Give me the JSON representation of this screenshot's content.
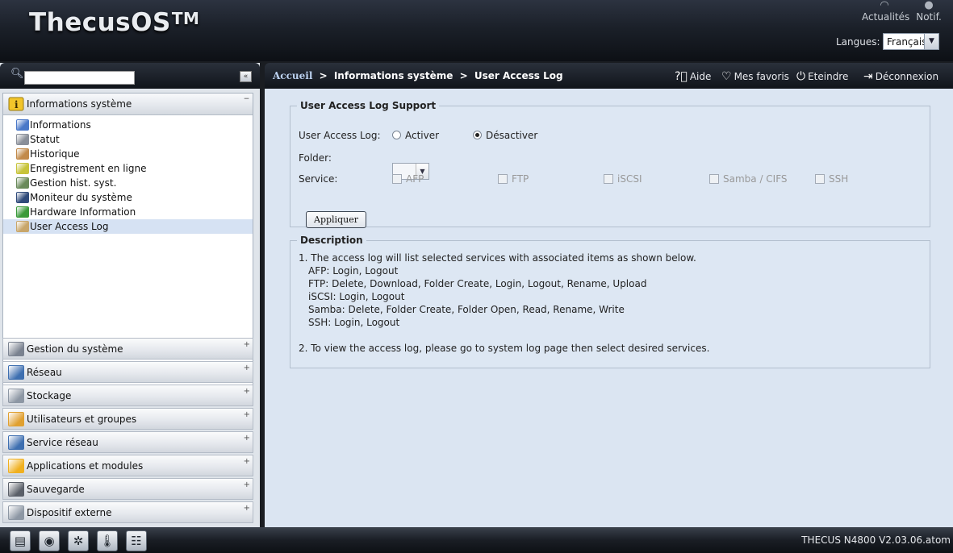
{
  "header": {
    "logo": "ThecusOS",
    "logo_tm": "TM",
    "news_label": "Actualités",
    "notif_label": "Notif.",
    "lang_label": "Langues:",
    "lang_value": "Français"
  },
  "sidebar": {
    "search_placeholder": "",
    "open_category": "Informations système",
    "items": [
      {
        "label": "Informations",
        "icon": "info-monitor-icon",
        "color": "#4a78c8"
      },
      {
        "label": "Statut",
        "icon": "status-icon",
        "color": "#8a8f99"
      },
      {
        "label": "Historique",
        "icon": "history-icon",
        "color": "#c28a4a"
      },
      {
        "label": "Enregistrement en ligne",
        "icon": "registration-icon",
        "color": "#c7c43a"
      },
      {
        "label": "Gestion hist. syst.",
        "icon": "log-management-icon",
        "color": "#6a8a5a"
      },
      {
        "label": "Moniteur du système",
        "icon": "system-monitor-icon",
        "color": "#2f4a7a"
      },
      {
        "label": "Hardware Information",
        "icon": "hardware-icon",
        "color": "#3a9a3a"
      },
      {
        "label": "User Access Log",
        "icon": "user-access-log-icon",
        "color": "#c8a66a"
      }
    ],
    "categories": [
      {
        "label": "Gestion du système",
        "icon": "tools-icon"
      },
      {
        "label": "Réseau",
        "icon": "network-icon"
      },
      {
        "label": "Stockage",
        "icon": "storage-icon"
      },
      {
        "label": "Utilisateurs et groupes",
        "icon": "users-icon"
      },
      {
        "label": "Service réseau",
        "icon": "network-service-icon"
      },
      {
        "label": "Applications et modules",
        "icon": "apps-icon"
      },
      {
        "label": "Sauvegarde",
        "icon": "backup-icon"
      },
      {
        "label": "Dispositif externe",
        "icon": "external-device-icon"
      }
    ]
  },
  "breadcrumb": {
    "home": "Accueil",
    "sep": ">",
    "level1": "Informations système",
    "level2": "User Access Log"
  },
  "toolbar": {
    "help": "Aide",
    "favorites": "Mes favoris",
    "shutdown": "Eteindre",
    "logout": "Déconnexion"
  },
  "support": {
    "legend": "User Access Log Support",
    "log_label": "User Access Log:",
    "enable_label": "Activer",
    "disable_label": "Désactiver",
    "selected": "disable",
    "folder_label": "Folder:",
    "folder_value": "",
    "service_label": "Service:",
    "services": [
      "AFP",
      "FTP",
      "iSCSI",
      "Samba / CIFS",
      "SSH"
    ],
    "apply_label": "Appliquer"
  },
  "description": {
    "legend": "Description",
    "lines": [
      "1. The access log will list selected services with associated items as shown below.",
      "AFP: Login, Logout",
      "FTP: Delete, Download, Folder Create, Login, Logout, Rename, Upload",
      "iSCSI: Login, Logout",
      "Samba: Delete, Folder Create, Folder Open, Read, Rename, Write",
      "SSH: Login, Logout",
      "2. To view the access log, please go to system log page then select desired services."
    ]
  },
  "footer": {
    "version": "THECUS N4800 V2.03.06.atom",
    "dock": [
      "system-status-icon",
      "disk-icon",
      "fan-icon",
      "temperature-icon",
      "network-topology-icon"
    ]
  },
  "colors": {
    "accent": "#bcd2f0",
    "content_bg": "#dbe5f2",
    "selected_row": "#d6e2f3"
  }
}
